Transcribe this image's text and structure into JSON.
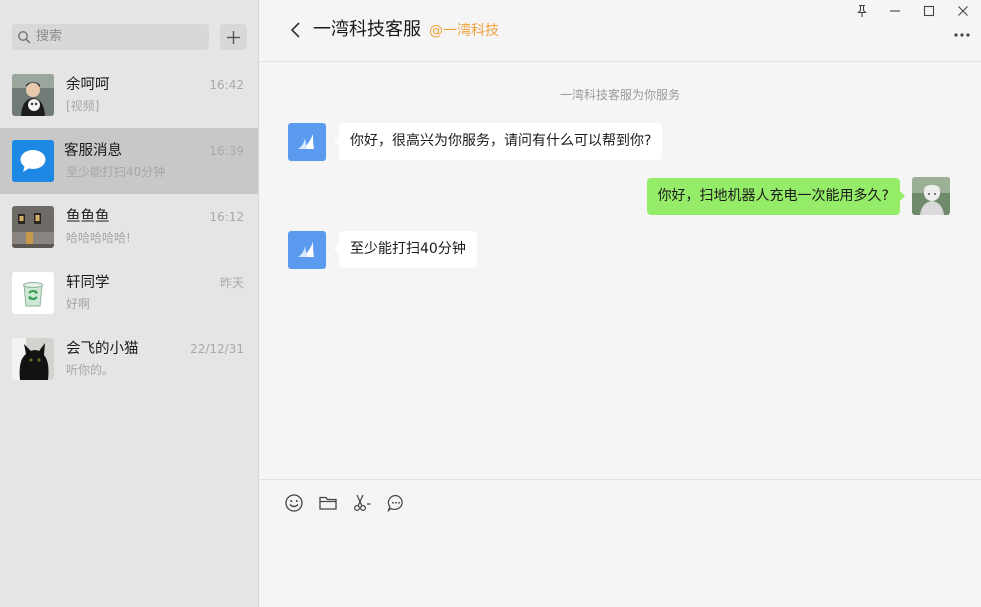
{
  "search": {
    "placeholder": "搜索"
  },
  "conversations": [
    {
      "name": "余呵呵",
      "time": "16:42",
      "preview": "[视频]",
      "avatar": "person-photo-avatar"
    },
    {
      "name": "客服消息",
      "time": "16:39",
      "preview": "至少能打扫40分钟",
      "avatar": "chat-bubble-icon",
      "active": true
    },
    {
      "name": "鱼鱼鱼",
      "time": "16:12",
      "preview": "哈哈哈哈哈!",
      "avatar": "room-photo-avatar"
    },
    {
      "name": "轩同学",
      "time": "昨天",
      "preview": "好啊",
      "avatar": "recycle-bin-avatar"
    },
    {
      "name": "会飞的小猫",
      "time": "22/12/31",
      "preview": "听你的。",
      "avatar": "black-cat-avatar"
    }
  ],
  "chat": {
    "title": "一湾科技客服",
    "subtitle": "@一湾科技",
    "system_note": "一湾科技客服为你服务",
    "messages": [
      {
        "direction": "in",
        "text": "你好，很高兴为你服务，请问有什么可以帮到你?"
      },
      {
        "direction": "out",
        "text": "你好，扫地机器人充电一次能用多久?"
      },
      {
        "direction": "in",
        "text": "至少能打扫40分钟"
      }
    ]
  },
  "colors": {
    "accent_orange": "#f0a13b",
    "outgoing_bubble": "#95ec69",
    "service_avatar": "#5a9bf0",
    "sidebar_bg": "#e6e5e5",
    "active_item_bg": "#c9c8c8"
  },
  "icons": {
    "window_controls": [
      "pin-icon",
      "minimize-icon",
      "maximize-icon",
      "close-icon"
    ],
    "toolbar": [
      "emoji-icon",
      "folder-icon",
      "scissors-icon",
      "chat-history-icon"
    ]
  }
}
